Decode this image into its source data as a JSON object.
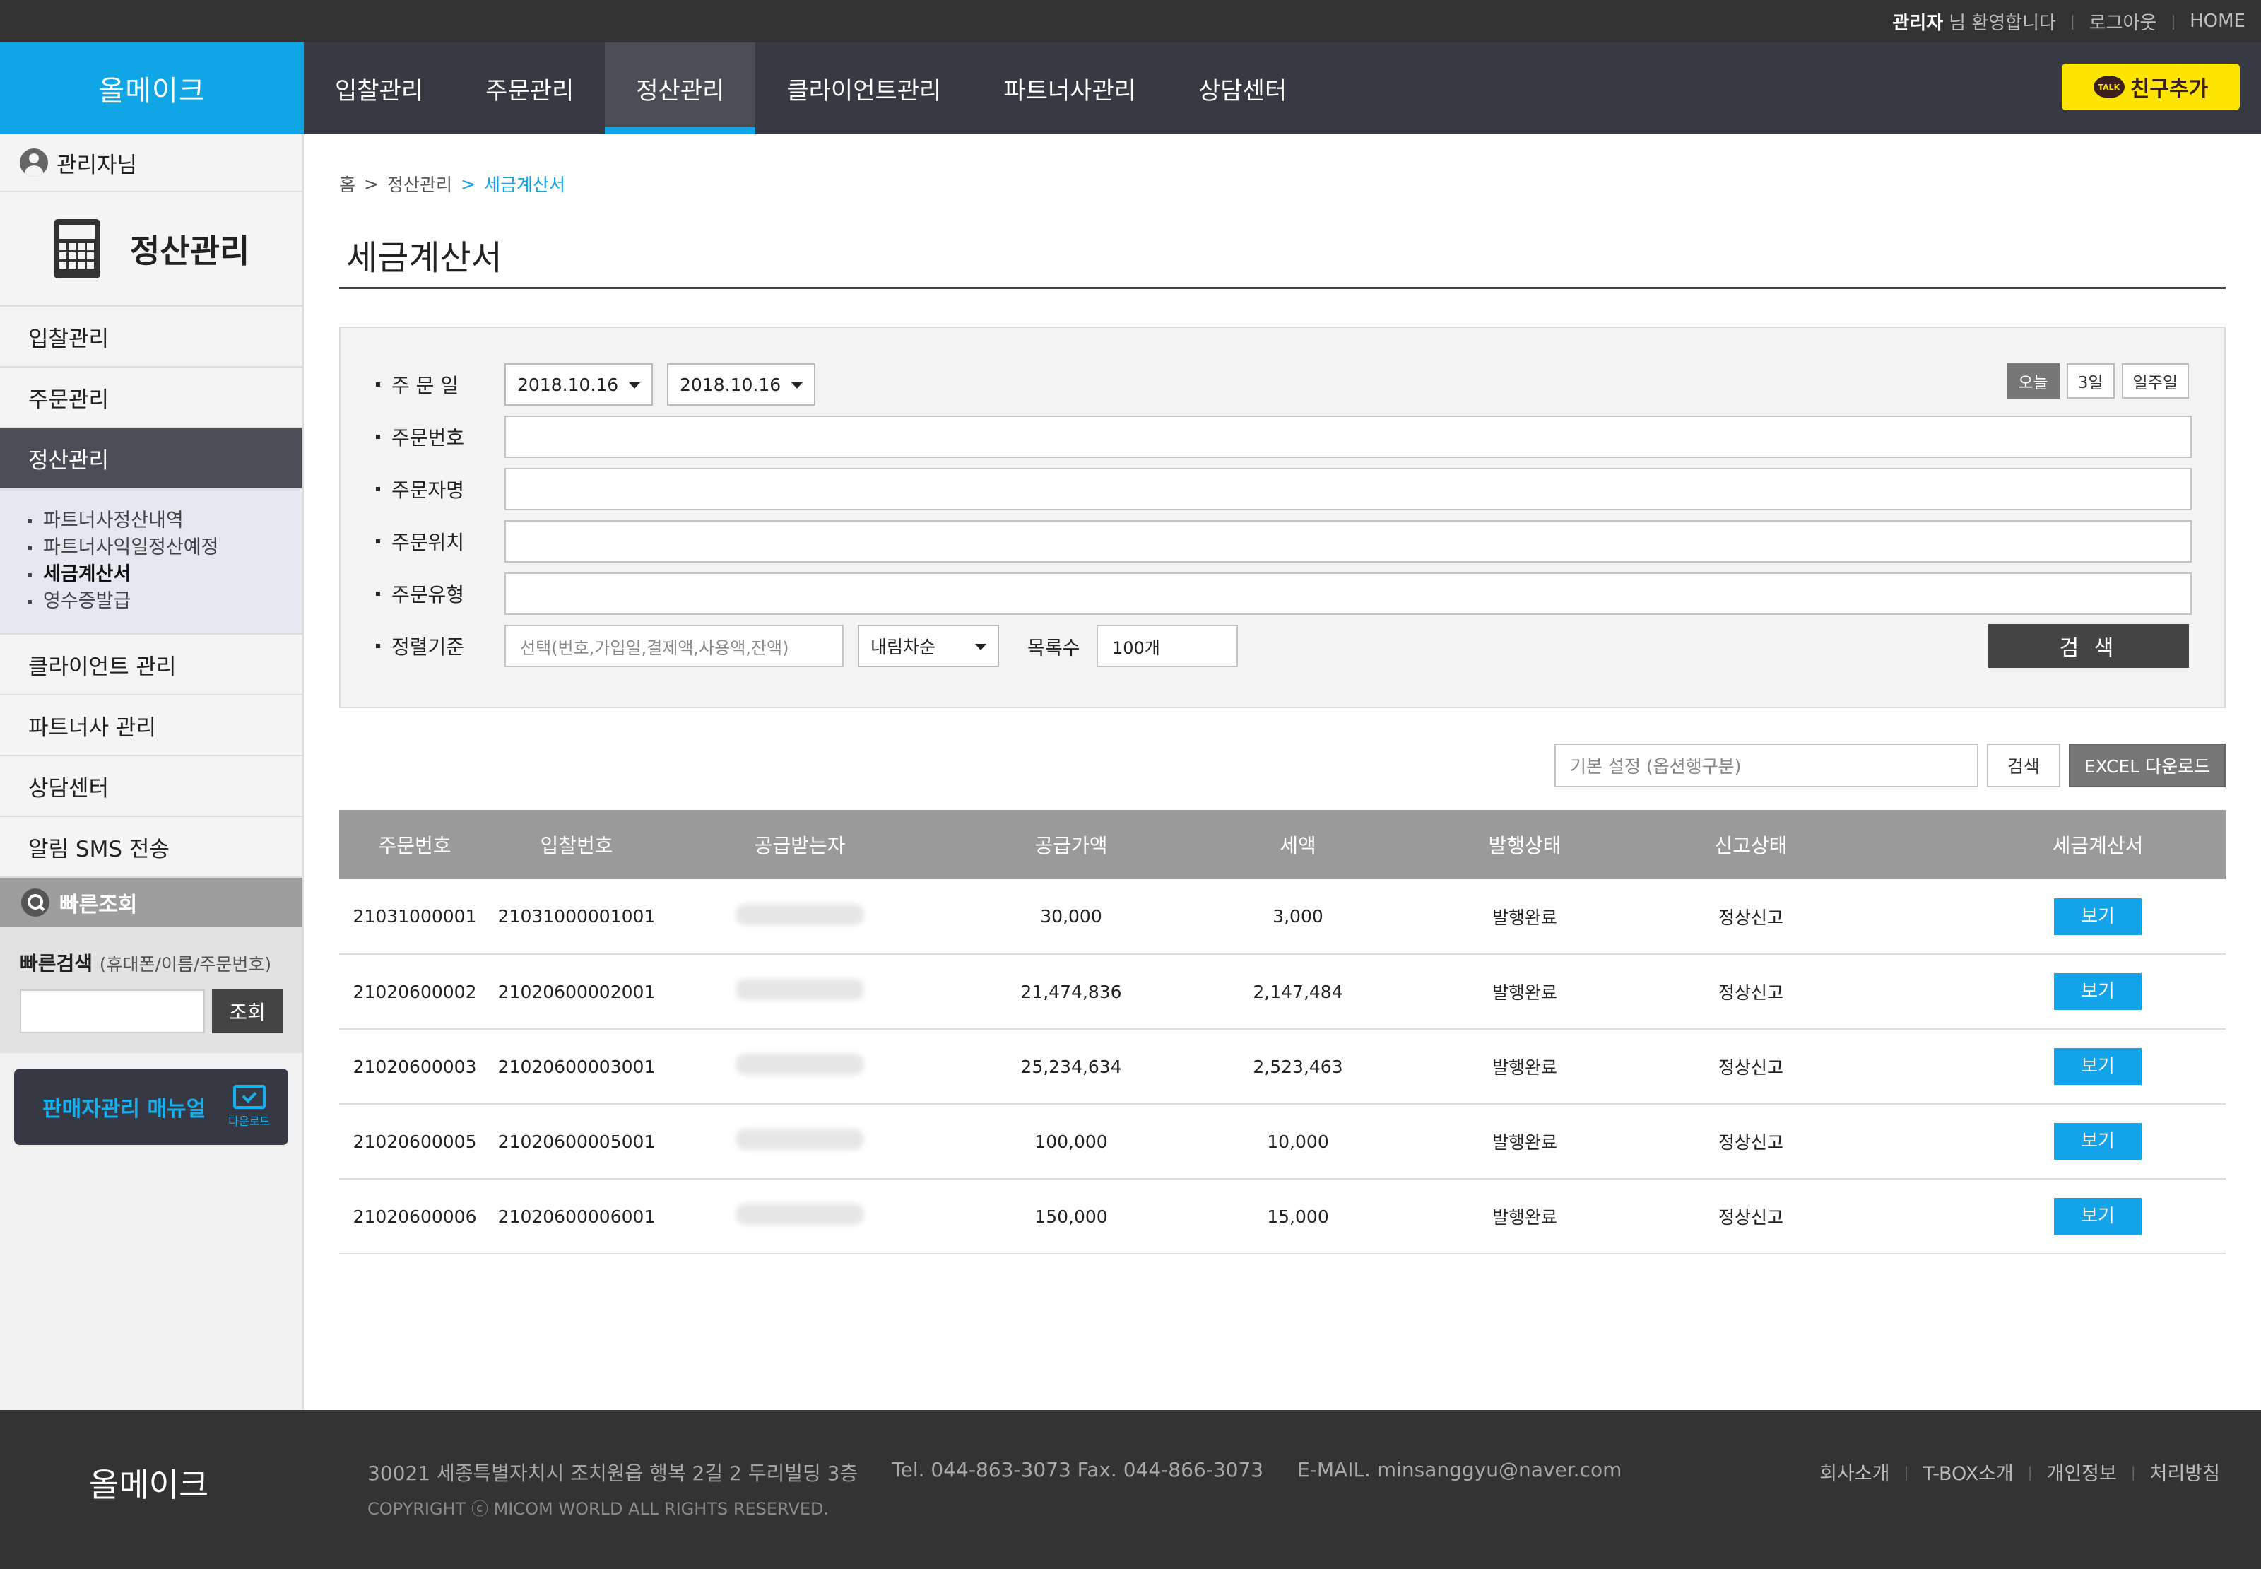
{
  "topbar": {
    "admin_name": "관리자",
    "welcome": "님 환영합니다",
    "logout": "로그아웃",
    "home": "HOME"
  },
  "header": {
    "logo": "올메이크",
    "nav": [
      "입찰관리",
      "주문관리",
      "정산관리",
      "클라이언트관리",
      "파트너사관리",
      "상담센터"
    ],
    "active_nav": "정산관리",
    "kakao_label": "친구추가",
    "kakao_talk": "TALK",
    "kakao_color": "#fee500",
    "accent_color": "#10a6e6"
  },
  "sidebar": {
    "user": "관리자님",
    "section_title": "정산관리",
    "menu": {
      "bid": "입찰관리",
      "order": "주문관리",
      "settle": "정산관리",
      "client": "클라이언트 관리",
      "partner": "파트너사 관리",
      "consult": "상담센터",
      "sms": "알림 SMS 전송"
    },
    "sub": [
      "파트너사정산내역",
      "파트너사익일정산예정",
      "세금계산서",
      "영수증발급"
    ],
    "sub_active": "세금계산서",
    "quick": {
      "title": "빠른조회",
      "label": "빠른검색",
      "hint": "(휴대폰/이름/주문번호)",
      "button": "조회"
    },
    "manual": {
      "label": "판매자관리 매뉴얼",
      "download": "다운로드"
    }
  },
  "breadcrumb": {
    "home": "홈",
    "sep": ">",
    "level1": "정산관리",
    "current": "세금계산서"
  },
  "page": {
    "title": "세금계산서"
  },
  "filters": {
    "order_date_label": "주 문 일",
    "date_from": "2018.10.16",
    "date_to": "2018.10.16",
    "periods": [
      "오늘",
      "3일",
      "일주일"
    ],
    "period_active": "오늘",
    "order_no_label": "주문번호",
    "orderer_label": "주문자명",
    "location_label": "주문위치",
    "type_label": "주문유형",
    "sort_label": "정렬기준",
    "sort_placeholder": "선택(번호,가입일,결제액,사용액,잔액)",
    "order_dir": "내림차순",
    "count_label": "목록수",
    "count_value": "100개",
    "search_button": "검 색"
  },
  "tools": {
    "option_placeholder": "기본 설정 (옵션행구분)",
    "search": "검색",
    "excel": "EXCEL 다운로드"
  },
  "table": {
    "columns": [
      "주문번호",
      "입찰번호",
      "공급받는자",
      "공급가액",
      "세액",
      "발행상태",
      "신고상태",
      "세금계산서"
    ],
    "rows": [
      {
        "order_no": "21031000001",
        "bid_no": "21031000001001",
        "supply": "30,000",
        "tax": "3,000",
        "issue": "발행완료",
        "report": "정상신고",
        "action": "보기"
      },
      {
        "order_no": "21020600002",
        "bid_no": "21020600002001",
        "supply": "21,474,836",
        "tax": "2,147,484",
        "issue": "발행완료",
        "report": "정상신고",
        "action": "보기"
      },
      {
        "order_no": "21020600003",
        "bid_no": "21020600003001",
        "supply": "25,234,634",
        "tax": "2,523,463",
        "issue": "발행완료",
        "report": "정상신고",
        "action": "보기"
      },
      {
        "order_no": "21020600005",
        "bid_no": "21020600005001",
        "supply": "100,000",
        "tax": "10,000",
        "issue": "발행완료",
        "report": "정상신고",
        "action": "보기"
      },
      {
        "order_no": "21020600006",
        "bid_no": "21020600006001",
        "supply": "150,000",
        "tax": "15,000",
        "issue": "발행완료",
        "report": "정상신고",
        "action": "보기"
      }
    ]
  },
  "footer": {
    "logo": "올메이크",
    "address": "30021 세종특별자치시 조치원읍 행복 2길 2 두리빌딩 3층",
    "tel": "Tel. 044-863-3073 Fax. 044-866-3073",
    "email": "E-MAIL. minsanggyu@naver.com",
    "copyright": "COPYRIGHT ⓒ MICOM WORLD ALL RIGHTS RESERVED.",
    "links": [
      "회사소개",
      "T-BOX소개",
      "개인정보",
      "처리방침"
    ]
  }
}
